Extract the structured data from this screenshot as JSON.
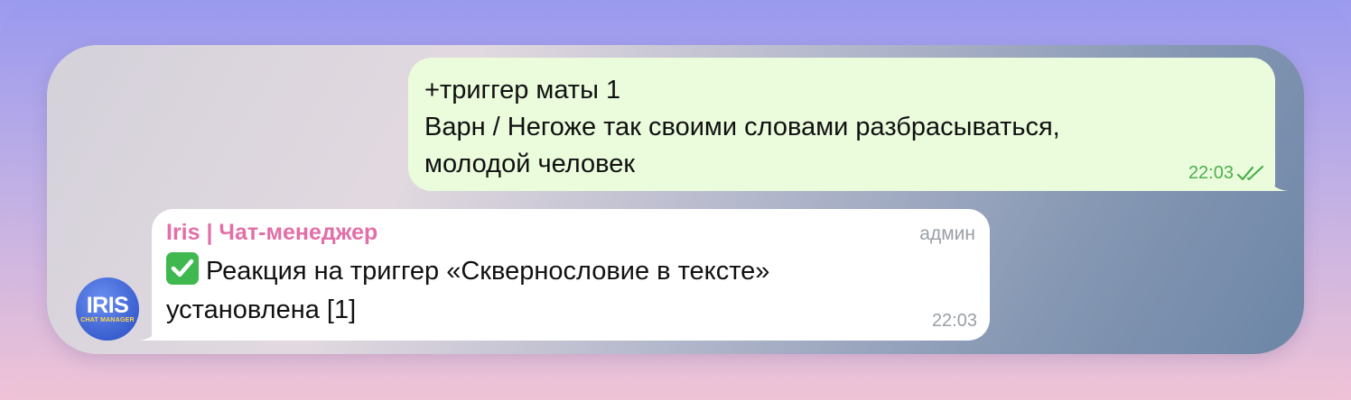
{
  "outgoing_message": {
    "lines": [
      "+триггер маты 1",
      "Варн / Негоже так своими словами разбрасываться,",
      "молодой человек"
    ],
    "time": "22:03",
    "status_icon": "double-check-icon",
    "status_color": "#4fae4e",
    "bubble_color": "#eafcdc"
  },
  "incoming_message": {
    "sender": "Iris | Чат-менеджер",
    "sender_color": "#e26fa8",
    "badge": "админ",
    "emoji_icon": "check-mark-button-icon",
    "text_line1": "Реакция на триггер «Сквернословие в тексте»",
    "text_line2": "установлена [1]",
    "time": "22:03"
  },
  "avatar": {
    "title": "IRIS",
    "subtitle": "CHAT MANAGER",
    "color": "#3a5fd0"
  }
}
